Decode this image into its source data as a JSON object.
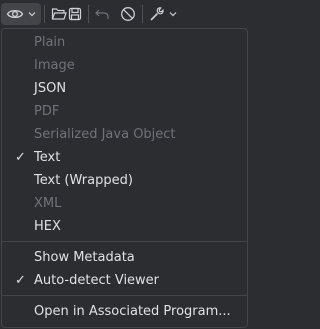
{
  "toolbar": {
    "buttons": [
      {
        "icon": "eye-icon",
        "has_dropdown": true
      },
      {
        "icon": "folder-open-icon"
      },
      {
        "icon": "save-icon"
      },
      {
        "icon": "undo-icon",
        "disabled": true
      },
      {
        "icon": "cancel-icon"
      },
      {
        "icon": "wrench-icon",
        "has_dropdown": true
      }
    ]
  },
  "menu": {
    "items": [
      {
        "label": "Plain",
        "enabled": false,
        "checked": false
      },
      {
        "label": "Image",
        "enabled": false,
        "checked": false
      },
      {
        "label": "JSON",
        "enabled": true,
        "checked": false
      },
      {
        "label": "PDF",
        "enabled": false,
        "checked": false
      },
      {
        "label": "Serialized Java Object",
        "enabled": false,
        "checked": false
      },
      {
        "label": "Text",
        "enabled": true,
        "checked": true
      },
      {
        "label": "Text (Wrapped)",
        "enabled": true,
        "checked": false
      },
      {
        "label": "XML",
        "enabled": false,
        "checked": false
      },
      {
        "label": "HEX",
        "enabled": true,
        "checked": false
      },
      {
        "label": "Show Metadata",
        "enabled": true,
        "checked": false
      },
      {
        "label": "Auto-detect Viewer",
        "enabled": true,
        "checked": true
      },
      {
        "label": "Open in Associated Program...",
        "enabled": true,
        "checked": false
      }
    ],
    "check_glyph": "✓"
  },
  "colors": {
    "background": "#2b2d30",
    "text": "#dfe1e5",
    "disabled_text": "#6f737a",
    "border": "#43454a",
    "active_button": "#43454a"
  }
}
